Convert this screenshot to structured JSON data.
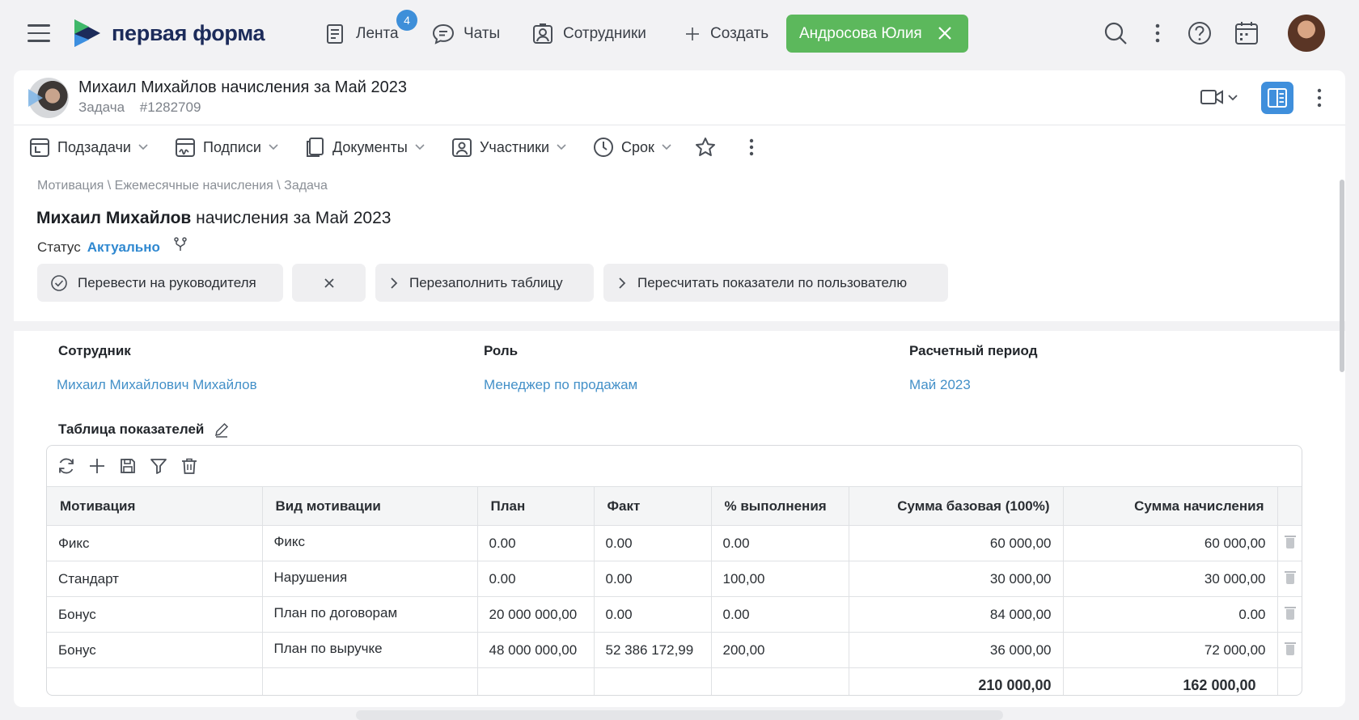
{
  "topbar": {
    "brand": "первая форма",
    "nav": [
      {
        "label": "Лента",
        "badge": "4"
      },
      {
        "label": "Чаты"
      },
      {
        "label": "Сотрудники"
      },
      {
        "label": "Создать"
      }
    ],
    "user_chip": "Андросова Юлия",
    "icons": [
      "search-icon",
      "more-vertical-icon",
      "help-icon",
      "calendar-icon"
    ]
  },
  "task": {
    "title": "Михаил Михайлов начисления за Май 2023",
    "type": "Задача",
    "number": "#1282709"
  },
  "toolbar": {
    "items": [
      "Подзадачи",
      "Подписи",
      "Документы",
      "Участники",
      "Срок"
    ]
  },
  "details": {
    "breadcrumb": "Мотивация \\ Ежемесячные начисления \\ Задача",
    "title_bold": "Михаил Михайлов",
    "title_rest": " начисления за Май 2023",
    "status_label": "Статус",
    "status_value": "Актуально",
    "actions": [
      "Перевести на руководителя",
      "Перезаполнить таблицу",
      "Пересчитать показатели по пользователю"
    ]
  },
  "fields": {
    "employee_label": "Сотрудник",
    "employee_value": "Михаил Михайлович Михайлов",
    "role_label": "Роль",
    "role_value": "Менеджер по продажам",
    "period_label": "Расчетный период",
    "period_value": "Май 2023"
  },
  "table": {
    "label": "Таблица показателей",
    "columns": [
      "Мотивация",
      "Вид мотивации",
      "План",
      "Факт",
      "% выполнения",
      "Сумма базовая (100%)",
      "Сумма начисления"
    ],
    "rows": [
      [
        "Фикс",
        "Фикс",
        "0.00",
        "0.00",
        "0.00",
        "60 000,00",
        "60 000,00"
      ],
      [
        "Стандарт",
        "Нарушения",
        "0.00",
        "0.00",
        "100,00",
        "30 000,00",
        "30 000,00"
      ],
      [
        "Бонус",
        "План по договорам",
        "20 000 000,00",
        "0.00",
        "0.00",
        "84 000,00",
        "0.00"
      ],
      [
        "Бонус",
        "План по выручке",
        "48 000 000,00",
        "52 386 172,99",
        "200,00",
        "36 000,00",
        "72 000,00"
      ]
    ],
    "totals": {
      "base": "210 000,00",
      "accrual": "162 000,00"
    }
  },
  "colors": {
    "accent": "#3e8fd9",
    "chip": "#5cb85c",
    "link": "#4390c8"
  }
}
